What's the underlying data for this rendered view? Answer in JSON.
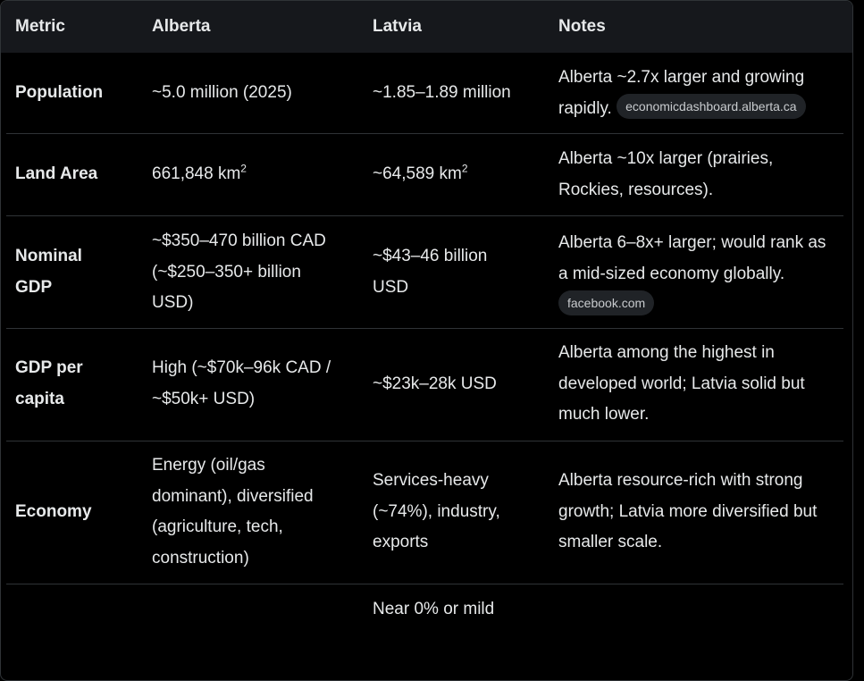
{
  "table": {
    "headers": {
      "metric": "Metric",
      "alberta": "Alberta",
      "latvia": "Latvia",
      "notes": "Notes"
    },
    "rows": [
      {
        "metric": "Population",
        "alberta": "~5.0 million (2025)",
        "latvia": "~1.85–1.89 million",
        "notes_line1": "Alberta ~2.7x larger and growing",
        "notes_line2": "rapidly.",
        "source": "economicdashboard.alberta.ca"
      },
      {
        "metric": "Land Area",
        "alberta": "661,848 km",
        "alberta_sup": "2",
        "latvia": "~64,589 km",
        "latvia_sup": "2",
        "notes": "Alberta ~10x larger (prairies, Rockies, resources)."
      },
      {
        "metric": "Nominal GDP",
        "alberta": "~$350–470 billion CAD (~$250–350+ billion USD)",
        "latvia": "~$43–46 billion USD",
        "notes": "Alberta 6–8x+ larger; would rank as a mid-sized economy globally.",
        "source": "facebook.com"
      },
      {
        "metric": "GDP per capita",
        "alberta": "High (~$70k–96k CAD / ~$50k+ USD)",
        "latvia": "~$23k–28k USD",
        "notes": "Alberta among the highest in developed world; Latvia solid but much lower."
      },
      {
        "metric": "Economy",
        "alberta": "Energy (oil/gas dominant), diversified (agriculture, tech, construction)",
        "latvia": "Services-heavy (~74%), industry, exports",
        "notes": "Alberta resource-rich with strong growth; Latvia more diversified but smaller scale."
      },
      {
        "latvia_partial": "Near 0% or mild"
      }
    ]
  }
}
